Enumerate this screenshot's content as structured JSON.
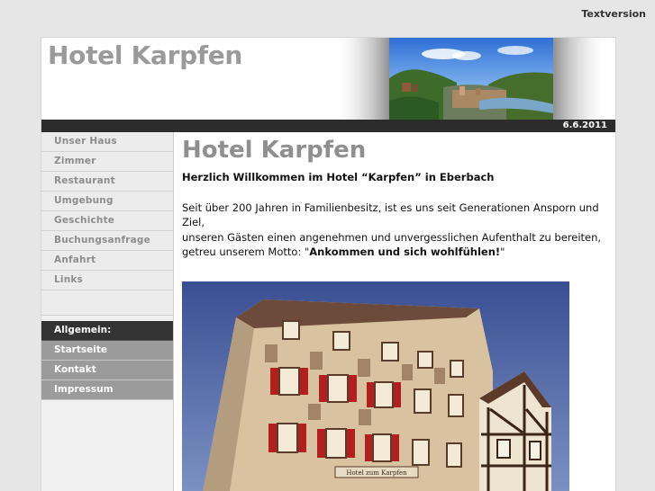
{
  "top": {
    "textversion": "Textversion"
  },
  "header": {
    "title": "Hotel Karpfen",
    "date": "6.6.2011"
  },
  "sidebar": {
    "items": [
      {
        "label": "Unser Haus"
      },
      {
        "label": "Zimmer"
      },
      {
        "label": "Restaurant"
      },
      {
        "label": "Umgebung"
      },
      {
        "label": "Geschichte"
      },
      {
        "label": "Buchungsanfrage"
      },
      {
        "label": "Anfahrt"
      },
      {
        "label": "Links"
      }
    ],
    "section_title": "Allgemein:",
    "general_items": [
      {
        "label": "Startseite"
      },
      {
        "label": "Kontakt"
      },
      {
        "label": "Impressum"
      }
    ]
  },
  "main": {
    "title": "Hotel Karpfen",
    "welcome": "Herzlich Willkommen im Hotel “Karpfen” in Eberbach",
    "line1": "Seit über 200 Jahren in Familienbesitz, ist es uns seit Generationen Ansporn und Ziel,",
    "line2": "unseren Gästen einen angenehmen und unvergesslichen Aufenthalt zu bereiten,",
    "line3_prefix": "getreu unserem Motto: \"",
    "motto": "Ankommen und sich wohlfühlen!",
    "line3_suffix": "\"",
    "photo_sign": "Hotel zum Karpfen"
  },
  "colors": {
    "page_bg": "#e6e6e6",
    "title_gray": "#9a9a9a",
    "dark_bar": "#2c2c2c",
    "nav_active_bg": "#9b9b9b",
    "section_bg": "#333333"
  }
}
